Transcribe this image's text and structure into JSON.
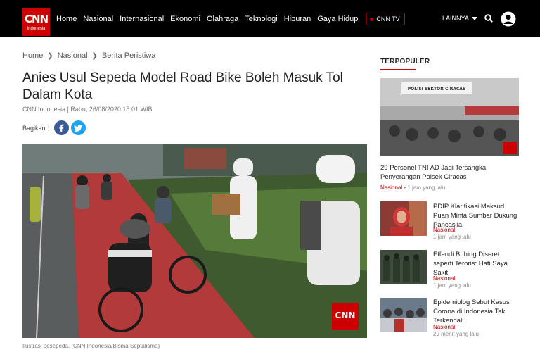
{
  "brand": {
    "logo_text": "CNN",
    "logo_sub": "Indonesia",
    "color": "#cc0000"
  },
  "nav": {
    "items": [
      "Home",
      "Nasional",
      "Internasional",
      "Ekonomi",
      "Olahraga",
      "Teknologi",
      "Hiburan",
      "Gaya Hidup"
    ],
    "tv_label": "CNN TV",
    "more_label": "LAINNYA"
  },
  "breadcrumb": [
    "Home",
    "Nasional",
    "Berita Peristiwa"
  ],
  "article": {
    "title": "Anies Usul Sepeda Model Road Bike Boleh Masuk Tol Dalam Kota",
    "byline": "CNN Indonesia | Rabu, 26/08/2020 15:01 WIB",
    "share_label": "Bagikan :",
    "caption": "Ilustrasi pesepeda. (CNN Indonesia/Bisma Septalisma)"
  },
  "sidebar": {
    "heading": "TERPOPULER",
    "featured": {
      "sign_text": "POLISI SEKTOR CIRACAS",
      "title": "29 Personel TNI AD Jadi Tersangka Penyerangan Polsek Ciracas",
      "category": "Nasional",
      "time": "1 jam yang lalu"
    },
    "items": [
      {
        "title": "PDIP Klarifikasi Maksud Puan Minta Sumbar Dukung Pancasila",
        "category": "Nasional",
        "time": "1 jam yang lalu"
      },
      {
        "title": "Effendi Buhing Diseret seperti Teroris: Hati Saya Sakit",
        "category": "Nasional",
        "time": "1 jam yang lalu"
      },
      {
        "title": "Epidemiolog Sebut Kasus Corona di Indonesia Tak Terkendali",
        "category": "Nasional",
        "time": "29 menit yang lalu"
      }
    ]
  }
}
